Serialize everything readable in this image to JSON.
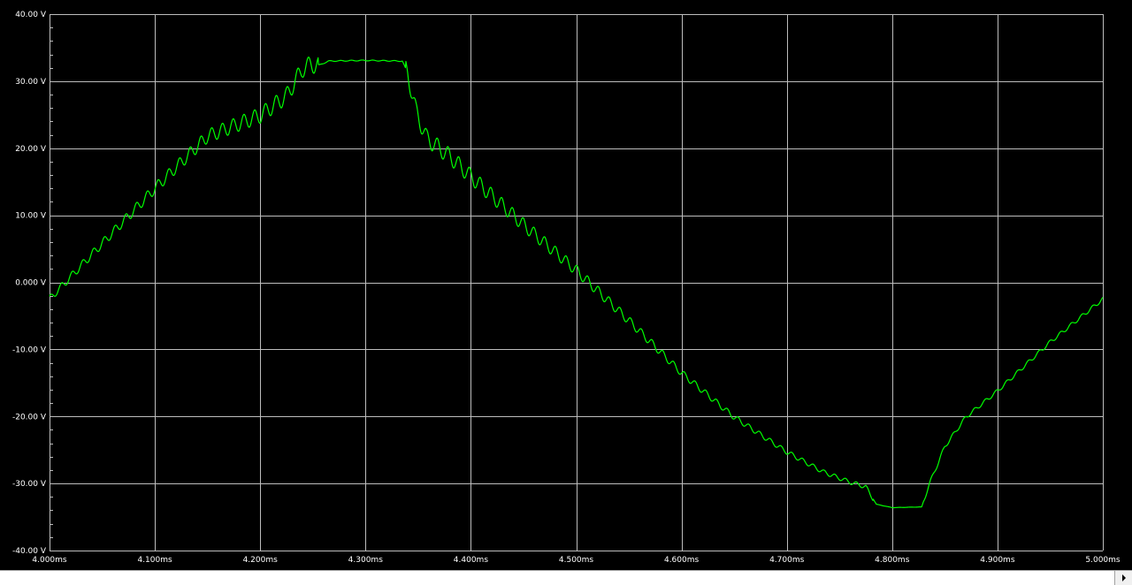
{
  "chart_data": {
    "type": "line",
    "title": "",
    "xlabel": "",
    "ylabel": "",
    "xlim": [
      4.0,
      5.0
    ],
    "ylim": [
      -40,
      40
    ],
    "x_unit": "ms",
    "y_unit": "V",
    "x_ticks": [
      4.0,
      4.1,
      4.2,
      4.3,
      4.4,
      4.5,
      4.6,
      4.7,
      4.8,
      4.9,
      5.0
    ],
    "x_tick_labels": [
      "4.000ms",
      "4.100ms",
      "4.200ms",
      "4.300ms",
      "4.400ms",
      "4.500ms",
      "4.600ms",
      "4.700ms",
      "4.800ms",
      "4.900ms",
      "5.000ms"
    ],
    "y_ticks": [
      40,
      30,
      20,
      10,
      0,
      -10,
      -20,
      -30,
      -40
    ],
    "y_tick_labels": [
      "40.00 V",
      "30.00 V",
      "20.00 V",
      "10.00 V",
      "0.000 V",
      "-10.00 V",
      "-20.00 V",
      "-30.00 V",
      "-40.00 V"
    ],
    "grid": true,
    "series": [
      {
        "color": "#00ff00",
        "x": [
          4.0,
          4.05,
          4.1,
          4.15,
          4.2,
          4.225,
          4.24,
          4.248,
          4.256,
          4.265,
          4.3,
          4.335,
          4.34,
          4.348,
          4.358,
          4.38,
          4.4,
          4.45,
          4.5,
          4.55,
          4.6,
          4.65,
          4.7,
          4.735,
          4.76,
          4.775,
          4.785,
          4.8,
          4.828,
          4.835,
          4.85,
          4.87,
          4.9,
          4.95,
          5.0
        ],
        "y": [
          -2.5,
          5.8,
          14.0,
          21.8,
          24.9,
          27.8,
          31.8,
          32.5,
          32.4,
          33.0,
          33.1,
          33.0,
          31.2,
          25.5,
          21.5,
          18.8,
          15.8,
          8.6,
          1.8,
          -5.7,
          -13.5,
          -20.1,
          -25.3,
          -28.3,
          -29.8,
          -30.5,
          -33.1,
          -33.6,
          -33.5,
          -30.2,
          -24.5,
          -20.1,
          -16.2,
          -8.9,
          -2.5
        ]
      }
    ]
  },
  "scrollbar": {
    "arrow_icon": "right-arrow-icon"
  }
}
